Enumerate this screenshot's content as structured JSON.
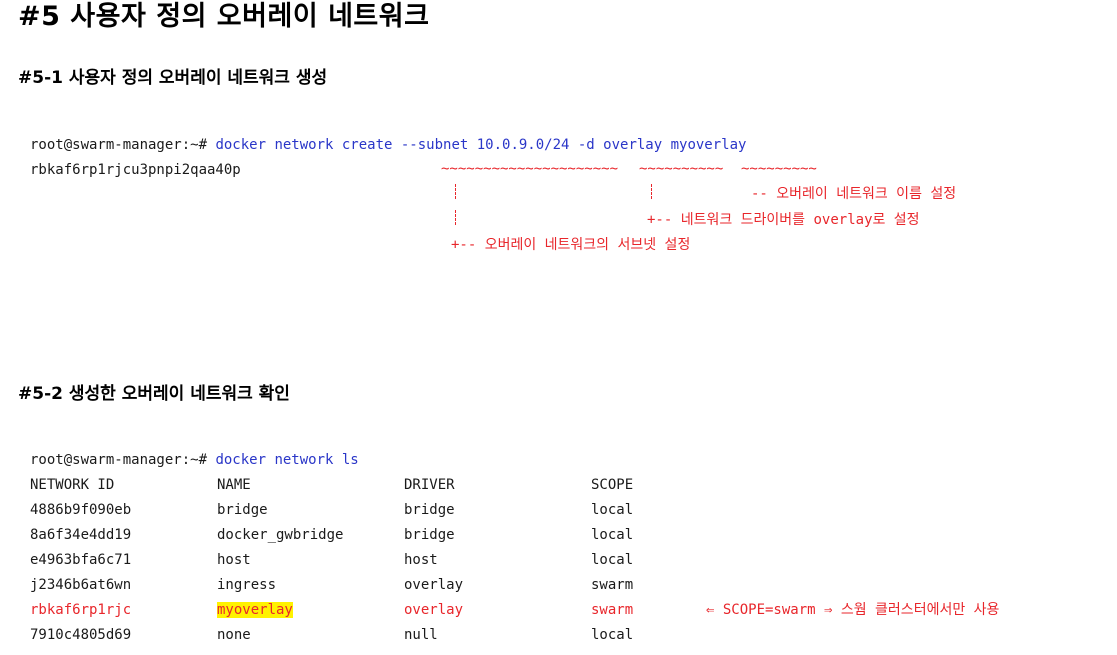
{
  "title": "#5 사용자 정의 오버레이 네트워크",
  "sections": [
    {
      "heading": "#5-1 사용자 정의 오버레이 네트워크 생성",
      "prompt": "root@swarm-manager:~# ",
      "command": "docker network create --subnet 10.0.9.0/24 -d overlay myoverlay",
      "output": "rbkaf6rp1rjcu3pnpi2qaa40p",
      "underline_subnet": "~~~~~~~~~~~~~~~~~~~~~",
      "underline_driver": "~~~~~~~~~~",
      "underline_name": "~~~~~~~~~",
      "annotations": {
        "name": "-- 오버레이 네트워크 이름 설정",
        "driver": "+-- 네트워크 드라이버를 overlay로 설정",
        "subnet": "+-- 오버레이 네트워크의 서브넷 설정"
      }
    },
    {
      "heading": "#5-2 생성한 오버레이 네트워크 확인",
      "prompt": "root@swarm-manager:~# ",
      "command": "docker network ls",
      "columns": [
        "NETWORK ID",
        "NAME",
        "DRIVER",
        "SCOPE"
      ],
      "rows": [
        {
          "id": "4886b9f090eb",
          "name": "bridge",
          "driver": "bridge",
          "scope": "local"
        },
        {
          "id": "8a6f34e4dd19",
          "name": "docker_gwbridge",
          "driver": "bridge",
          "scope": "local"
        },
        {
          "id": "e4963bfa6c71",
          "name": "host",
          "driver": "host",
          "scope": "local"
        },
        {
          "id": "j2346b6at6wn",
          "name": "ingress",
          "driver": "overlay",
          "scope": "swarm"
        },
        {
          "id": "rbkaf6rp1rjc",
          "name": "myoverlay",
          "driver": "overlay",
          "scope": "swarm"
        },
        {
          "id": "7910c4805d69",
          "name": "none",
          "driver": "null",
          "scope": "local"
        }
      ],
      "scope_note": "⇐ SCOPE=swarm ⇒ 스웜 클러스터에서만 사용"
    }
  ],
  "colors": {
    "prompt": "#1a1a1a",
    "command": "#2a36c8",
    "annotation": "#e8262b",
    "highlight": "#fff200"
  }
}
